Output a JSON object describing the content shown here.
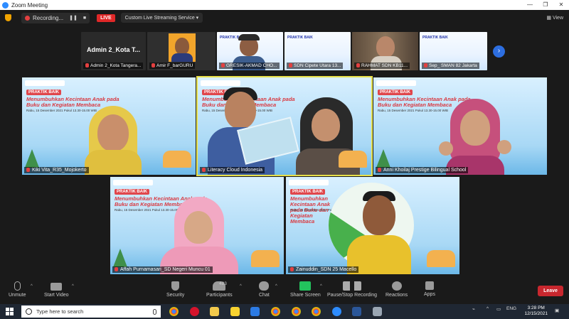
{
  "window": {
    "title": "Zoom Meeting"
  },
  "topbar": {
    "recording": "Recording...",
    "live": "LIVE",
    "streaming_service": "Custom Live Streaming Service",
    "view": "View"
  },
  "strip": [
    {
      "name": "Admin 2_Kota Tangera...",
      "big_label": "Admin 2_Kota T..."
    },
    {
      "name": "Amir F_barGURU"
    },
    {
      "name": "GRESIK-AKMAD CHO..."
    },
    {
      "name": "SDN Cipete Utara 13..."
    },
    {
      "name": "RAHMAT SDN KB11..."
    },
    {
      "name": "Sep_ SMAN 82 Jakarta"
    }
  ],
  "slide": {
    "badge": "PRAKTIK BAIK",
    "headline": "Menumbuhkan Kecintaan Anak pada Buku dan Kegiatan Membaca",
    "date": "Rabu, 15 Desember 2021 Pukul 13.30-15.00 WIB"
  },
  "tiles": [
    {
      "name": "Kiki Vita_R35_Mojokerto"
    },
    {
      "name": "Literacy Cloud Indonesia"
    },
    {
      "name": "Anni Khoilaj Prestige Bilingual School"
    },
    {
      "name": "Affah Purnamasari_SD Negeri Muncu 01"
    },
    {
      "name": "Zainuddin_SDN 25 Macello"
    }
  ],
  "toolbar": {
    "unmute": "Unmute",
    "start_video": "Start Video",
    "security": "Security",
    "participants": "Participants",
    "participants_count": "483",
    "chat": "Chat",
    "share_screen": "Share Screen",
    "pause_recording": "Pause/Stop Recording",
    "reactions": "Reactions",
    "apps": "Apps",
    "leave": "Leave"
  },
  "taskbar": {
    "search_placeholder": "Type here to search",
    "lang": "ENG",
    "time": "3:28 PM",
    "date": "12/15/2021"
  },
  "colors": {
    "accent": "#2d8cff",
    "live": "#e02828",
    "leave": "#c8272e",
    "active_speaker": "#e8e04a",
    "share_screen": "#23c45e"
  }
}
